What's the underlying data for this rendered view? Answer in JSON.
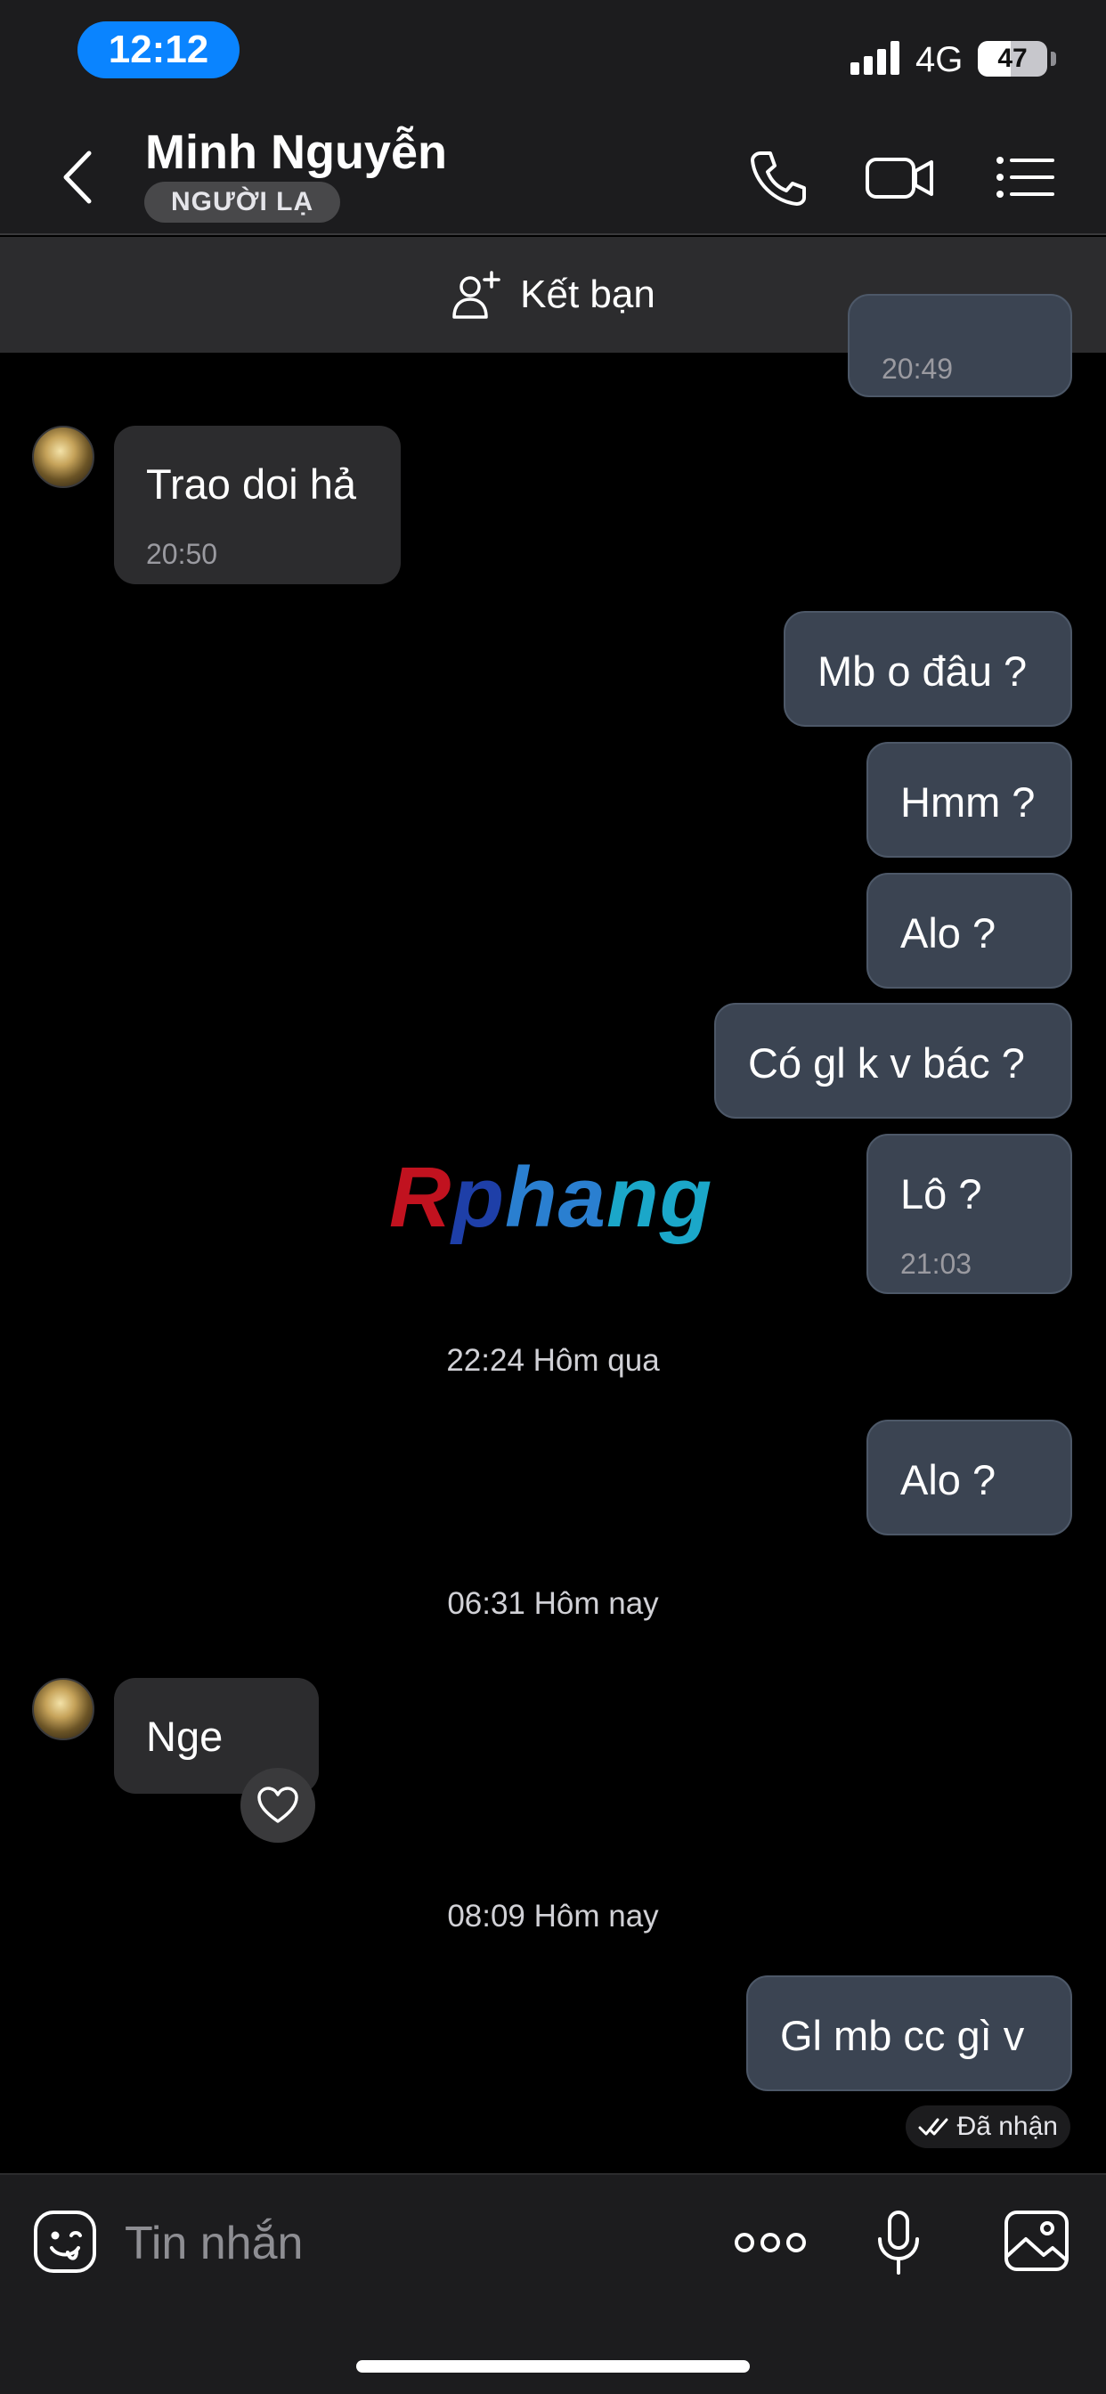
{
  "status_bar": {
    "time": "12:12",
    "network": "4G",
    "battery_level": "47",
    "battery_fraction": 0.47,
    "accent_color": "#0a84ff"
  },
  "header": {
    "contact_name": "Minh Nguyễn",
    "badge": "NGƯỜI LẠ",
    "icons": [
      "back-chevron-icon",
      "phone-icon",
      "video-camera-icon",
      "list-menu-icon"
    ]
  },
  "friend_bar": {
    "label": "Kết bạn",
    "icon": "add-person-icon"
  },
  "messages": [
    {
      "direction": "out",
      "text": "",
      "time": "20:49"
    },
    {
      "direction": "in",
      "text": "Trao doi hả",
      "time": "20:50"
    },
    {
      "direction": "out",
      "text": "Mb o đâu ?"
    },
    {
      "direction": "out",
      "text": "Hmm ?"
    },
    {
      "direction": "out",
      "text": "Alo ?"
    },
    {
      "direction": "out",
      "text": "Có gl k v bác ?"
    },
    {
      "direction": "out",
      "text": "Lô ?",
      "time": "21:03"
    },
    {
      "direction": "out",
      "text": "Alo ?"
    },
    {
      "direction": "in",
      "text": "Nge"
    },
    {
      "direction": "out",
      "text": "Gl mb cc gì v"
    }
  ],
  "separators": [
    "22:24 Hôm qua",
    "06:31 Hôm nay",
    "08:09 Hôm nay"
  ],
  "receipt": "Đã nhận",
  "watermark": {
    "r": "R",
    "p": "p",
    "h": "ha",
    "g": "ng"
  },
  "composer": {
    "placeholder": "Tin nhắn",
    "icons": [
      "sticker-emoji-icon",
      "more-options-icon",
      "microphone-icon",
      "image-gallery-icon"
    ]
  }
}
